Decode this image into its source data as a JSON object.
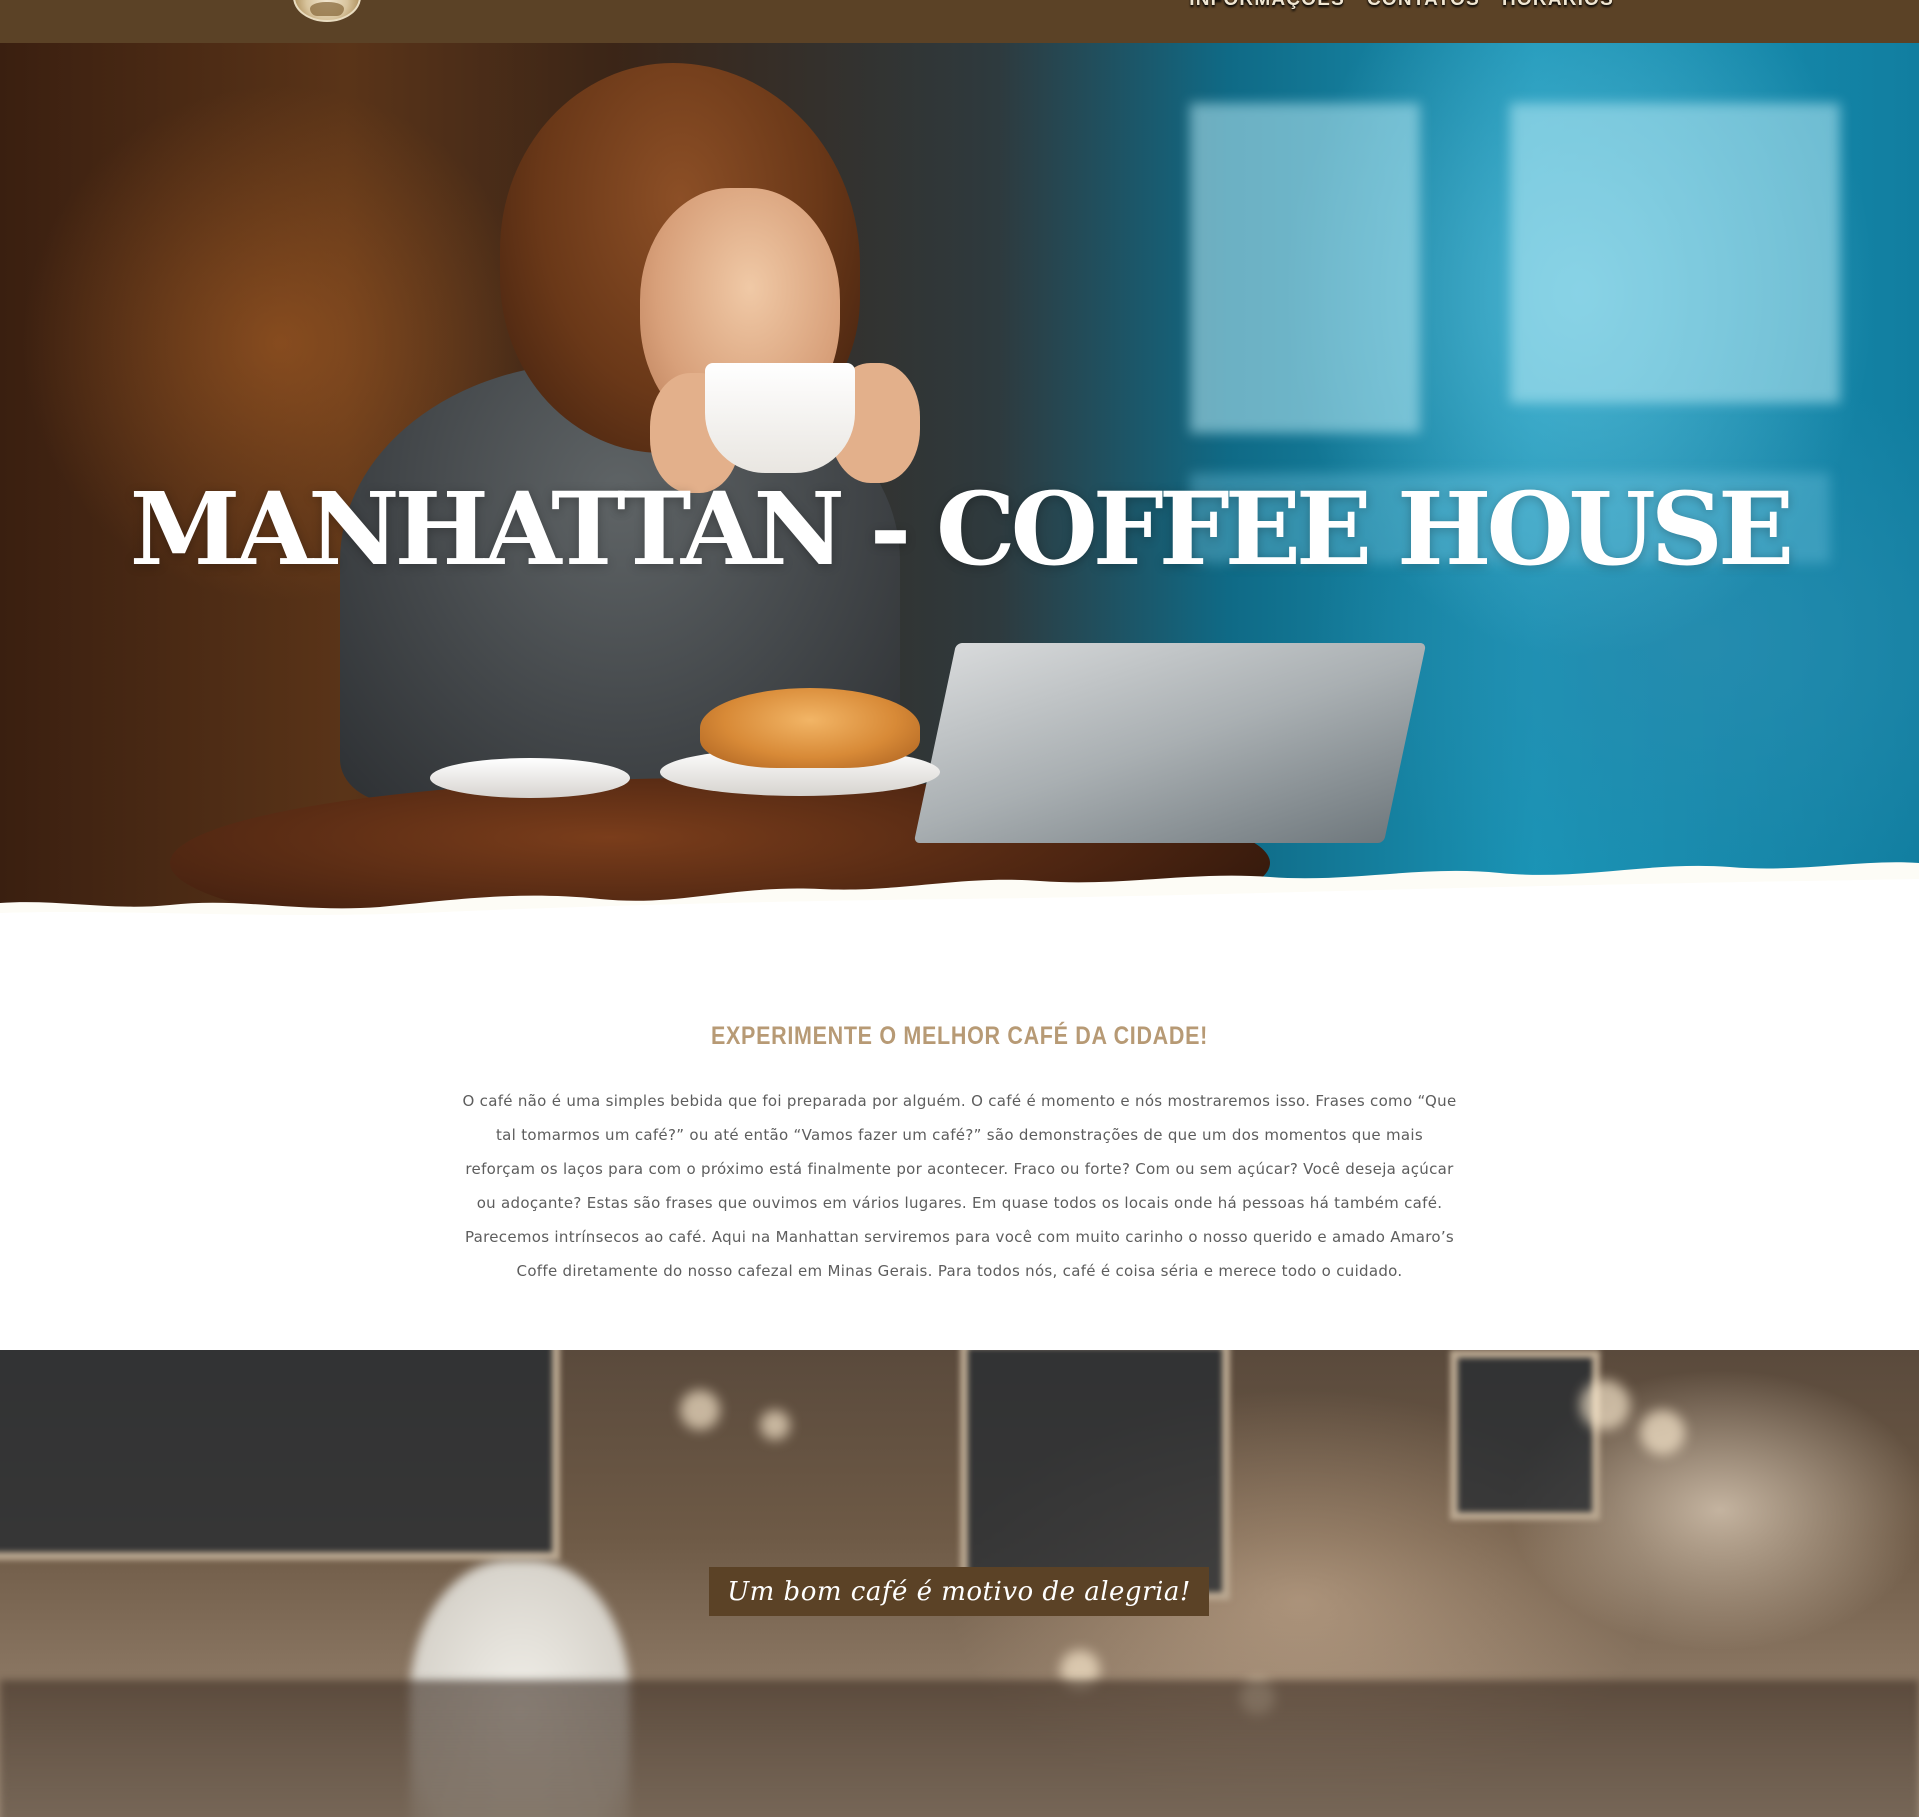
{
  "header": {
    "logo_icon": "coffee-house-logo",
    "nav": [
      "INFORMAÇÕES",
      "CONTATOS",
      "HORÁRIOS"
    ],
    "background_color": "#5b4226"
  },
  "hero": {
    "title": "MANHATTAN - COFFEE HOUSE"
  },
  "intro": {
    "heading": "EXPERIMENTE O MELHOR CAFÉ DA CIDADE!",
    "heading_color": "#b79a75",
    "paragraph": "O café não é uma simples bebida que foi preparada por alguém. O café é momento e nós mostraremos isso. Frases como “Que tal tomarmos um café?” ou até então “Vamos fazer um café?” são demonstrações de que um dos momentos que mais reforçam os laços para com o próximo está finalmente por acontecer. Fraco ou forte? Com ou sem açúcar? Você deseja açúcar ou adoçante? Estas são frases que ouvimos em vários lugares. Em quase todos os locais onde há pessoas há também café. Parecemos intrínsecos ao café. Aqui na Manhattan serviremos para você com muito carinho o nosso querido e amado Amaro’s Coffe diretamente do nosso cafezal em Minas Gerais. Para todos nós, café é coisa séria e merece todo o cuidado."
  },
  "quote": {
    "text": "Um bom café é motivo de alegria!",
    "box_color": "#5b4226"
  }
}
